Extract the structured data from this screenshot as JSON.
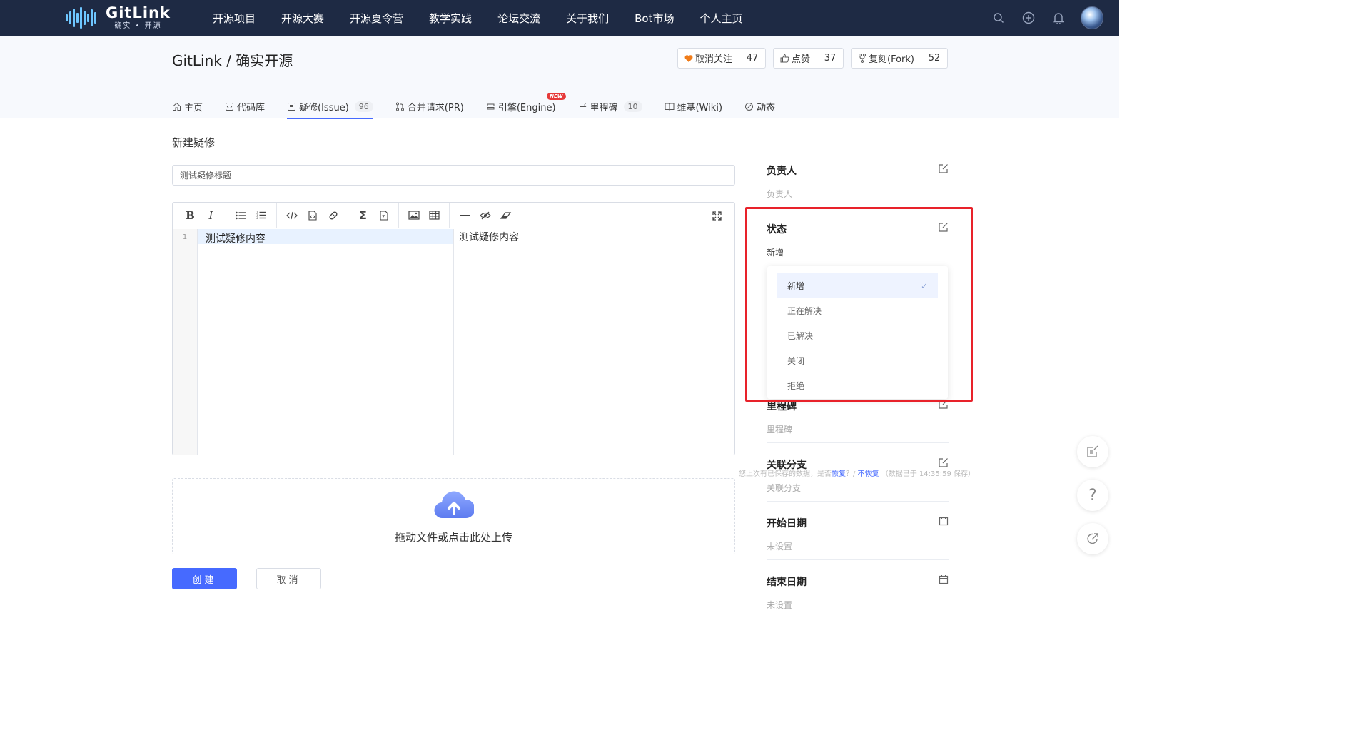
{
  "brand": {
    "title": "GitLink",
    "subtitle": "确实 • 开源"
  },
  "nav": {
    "items": [
      "开源项目",
      "开源大赛",
      "开源夏令营",
      "教学实践",
      "论坛交流",
      "关于我们",
      "Bot市场",
      "个人主页"
    ]
  },
  "repo": {
    "title": "GitLink / 确实开源",
    "actions": [
      {
        "label": "取消关注",
        "count": "47",
        "icon": "heart-icon"
      },
      {
        "label": "点赞",
        "count": "37",
        "icon": "thumbs-up-icon"
      },
      {
        "label": "复刻(Fork)",
        "count": "52",
        "icon": "fork-icon"
      }
    ],
    "tabs": [
      {
        "label": "主页",
        "icon": "home-icon",
        "badge": ""
      },
      {
        "label": "代码库",
        "icon": "code-icon",
        "badge": ""
      },
      {
        "label": "疑修(Issue)",
        "icon": "issue-icon",
        "badge": "96"
      },
      {
        "label": "合并请求(PR)",
        "icon": "merge-icon",
        "badge": ""
      },
      {
        "label": "引擎(Engine)",
        "icon": "engine-icon",
        "badge": "",
        "tag": "NEW"
      },
      {
        "label": "里程碑",
        "icon": "flag-icon",
        "badge": "10"
      },
      {
        "label": "维基(Wiki)",
        "icon": "book-icon",
        "badge": ""
      },
      {
        "label": "动态",
        "icon": "activity-icon",
        "badge": ""
      }
    ]
  },
  "form": {
    "heading": "新建疑修",
    "title_value": "测试疑修标题",
    "line_number": "1",
    "content": "测试疑修内容",
    "preview": "测试疑修内容",
    "restore_prefix": "您上次有已保存的数据，是否",
    "restore_yes": "恢复",
    "restore_sep": "？/ ",
    "restore_no": "不恢复",
    "restore_suffix": "（数据已于 14:35:59 保存）",
    "upload_text": "拖动文件或点击此处上传",
    "create_label": "创建",
    "cancel_label": "取消"
  },
  "sidebar": {
    "assignee": {
      "label": "负责人",
      "value": "负责人"
    },
    "status": {
      "label": "状态",
      "value": "新增"
    },
    "milestone": {
      "label": "里程碑",
      "value": "里程碑"
    },
    "branch": {
      "label": "关联分支",
      "value": "关联分支"
    },
    "start": {
      "label": "开始日期",
      "value": "未设置"
    },
    "end": {
      "label": "结束日期",
      "value": "未设置"
    }
  },
  "status_dropdown": {
    "options": [
      "新增",
      "正在解决",
      "已解决",
      "关闭",
      "拒绝"
    ],
    "selected": "新增"
  },
  "colors": {
    "nav_bg": "#1e2a44",
    "accent": "#466aff",
    "highlight": "#e8222a"
  }
}
